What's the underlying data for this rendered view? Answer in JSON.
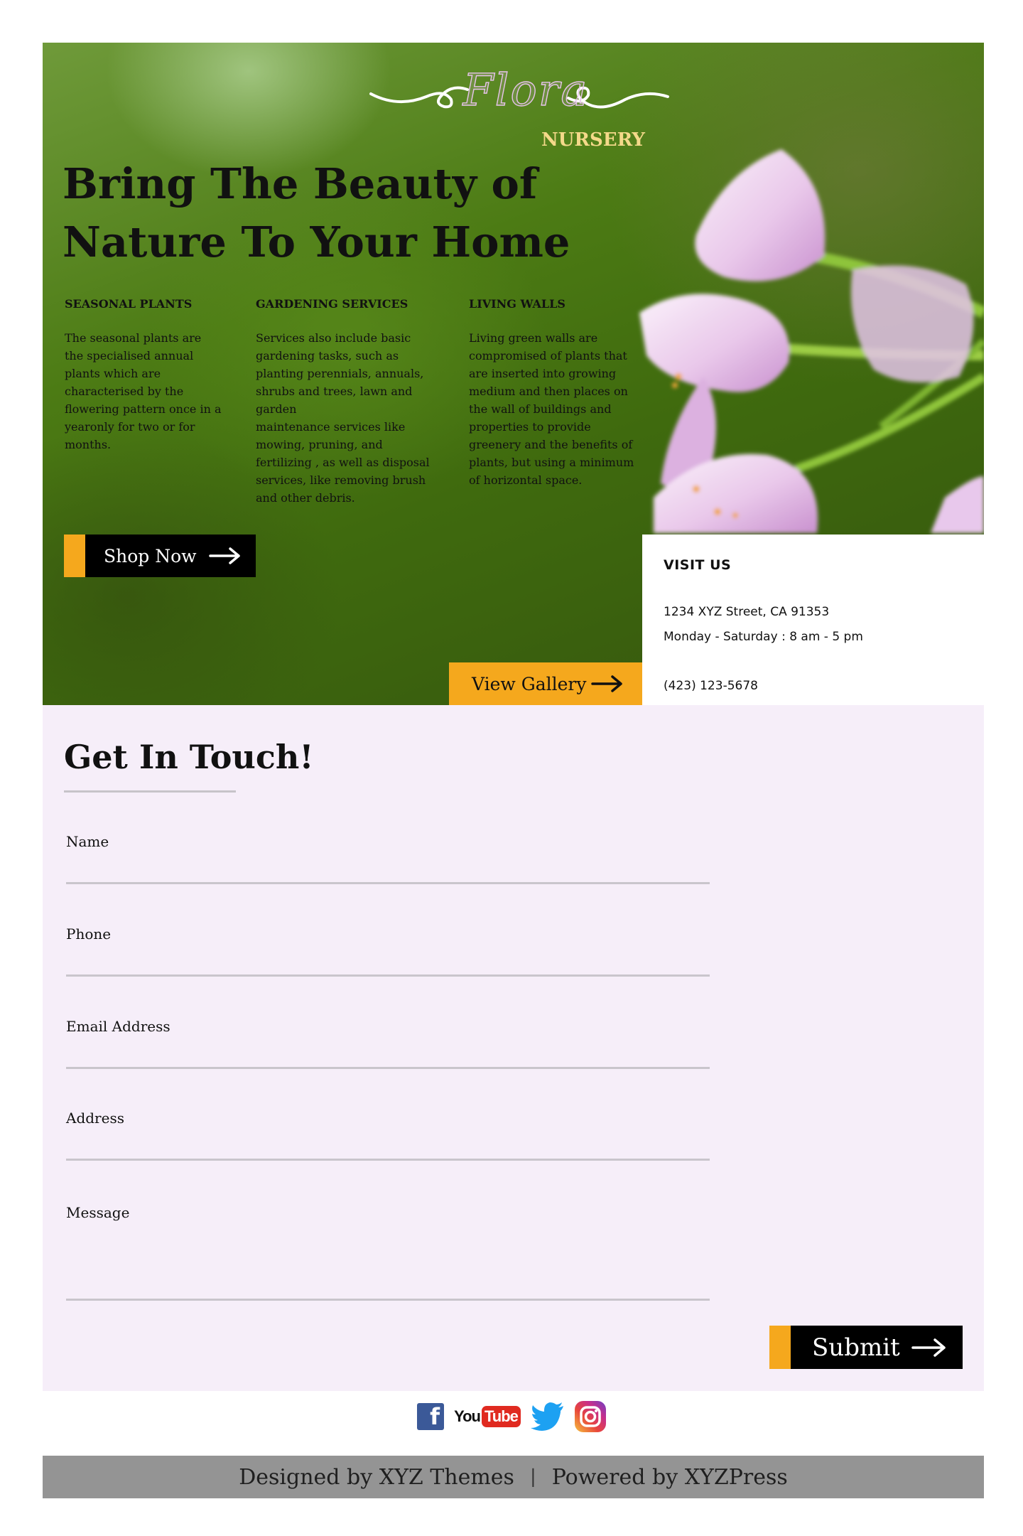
{
  "brand": {
    "logo_script": "Flora",
    "logo_sub": "NURSERY"
  },
  "hero": {
    "title_line1": "Bring The Beauty of",
    "title_line2": "Nature To Your Home",
    "columns": [
      {
        "heading": "SEASONAL PLANTS",
        "text": "The seasonal plants are\n the specialised annual\n plants which are\ncharacterised by the\nflowering pattern once in a\nyearonly for two or for\nmonths."
      },
      {
        "heading": "GARDENING SERVICES",
        "text": "Services also include basic\ngardening tasks, such as\nplanting perennials, annuals,\nshrubs and trees, lawn and\ngarden\nmaintenance services like\nmowing, pruning, and\nfertilizing , as well as disposal\nservices, like removing brush\nand other debris."
      },
      {
        "heading": "LIVING WALLS",
        "text": "Living green walls are\ncompromised of plants that\nare inserted into growing\nmedium and then places on\nthe wall of buildings and\nproperties to provide\ngreenery and the benefits of\nplants, but using a minimum\nof horizontal space."
      }
    ],
    "shop_label": "Shop Now",
    "gallery_label": "View Gallery"
  },
  "visit": {
    "heading": "VISIT US",
    "address": "1234 XYZ Street, CA 91353",
    "hours": "Monday - Saturday : 8 am - 5 pm",
    "phone": "(423) 123-5678"
  },
  "contact": {
    "title": "Get In Touch!",
    "fields": {
      "name": "Name",
      "phone": "Phone",
      "email": "Email Address",
      "address": "Address",
      "message": "Message"
    },
    "submit_label": "Submit"
  },
  "social": {
    "facebook_glyph": "f",
    "youtube_you": "You",
    "youtube_tube": "Tube",
    "icons": [
      "facebook-icon",
      "youtube-icon",
      "twitter-icon",
      "instagram-icon"
    ]
  },
  "footer": {
    "designed": "Designed by XYZ Themes",
    "separator": "|",
    "powered": "Powered by XYZPress"
  },
  "colors": {
    "accent": "#f5a81d",
    "button_bg": "#000000",
    "contact_bg": "#f6eef9",
    "footer_bg": "#949494",
    "logo_sub": "#f4d98a"
  }
}
